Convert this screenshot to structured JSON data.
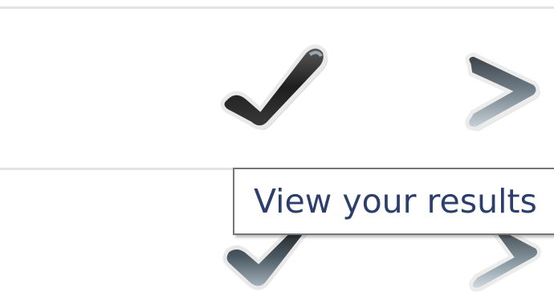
{
  "rows": [
    {
      "status_icon": "checkmark-icon",
      "action_icon": "next-arrow-icon"
    },
    {
      "status_icon": "checkmark-icon",
      "action_icon": "next-arrow-icon"
    }
  ],
  "tooltip": {
    "text": "View your results"
  },
  "colors": {
    "divider": "#e3e3e3",
    "icon_dark": "#2b2b2b",
    "icon_highlight": "#8a9aa6",
    "tooltip_border": "#767676",
    "tooltip_text": "#2c3e6c"
  }
}
